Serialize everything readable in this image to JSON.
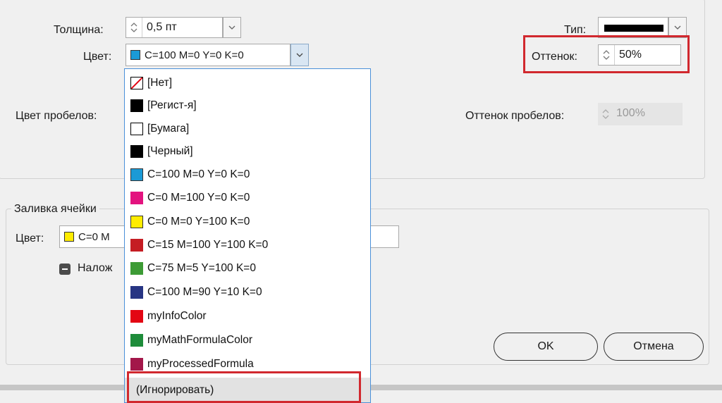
{
  "stroke": {
    "thickness_label": "Толщина:",
    "thickness_value": "0,5 пт",
    "color_label": "Цвет:",
    "color_value": "C=100 M=0 Y=0 K=0",
    "type_label": "Тип:",
    "tint_label": "Оттенок:",
    "tint_value": "50%",
    "gap_color_label": "Цвет пробелов:",
    "gap_tint_label": "Оттенок пробелов:",
    "gap_tint_value": "100%"
  },
  "cell_fill": {
    "legend": "Заливка ячейки",
    "color_label": "Цвет:",
    "color_value_partial": "C=0 M",
    "overprint_label_partial": "Налож"
  },
  "buttons": {
    "ok": "OK",
    "cancel": "Отмена"
  },
  "swatch_menu": {
    "items": [
      {
        "label": "[Нет]",
        "swatch": "none"
      },
      {
        "label": "[Регист-я]",
        "swatch": "#000000"
      },
      {
        "label": "[Бумага]",
        "swatch": "#ffffff"
      },
      {
        "label": "[Черный]",
        "swatch": "#000000"
      },
      {
        "label": "C=100 M=0 Y=0 K=0",
        "swatch": "#1b9ad6"
      },
      {
        "label": "C=0 M=100 Y=0 K=0",
        "swatch": "#e3137f"
      },
      {
        "label": "C=0 M=0 Y=100 K=0",
        "swatch": "#ffec00"
      },
      {
        "label": "C=15 M=100 Y=100 K=0",
        "swatch": "#c51d23"
      },
      {
        "label": "C=75 M=5 Y=100 K=0",
        "swatch": "#3d9b35"
      },
      {
        "label": "C=100 M=90 Y=10 K=0",
        "swatch": "#273583"
      },
      {
        "label": "myInfoColor",
        "swatch": "#e30613"
      },
      {
        "label": "myMathFormulaColor",
        "swatch": "#1e8c3a"
      },
      {
        "label": "myProcessedFormula",
        "swatch": "#a3174a"
      }
    ],
    "ignore_label": "(Игнорировать)"
  },
  "colors": {
    "highlight_red": "#d1282e",
    "accent_blue": "#4a90d9"
  }
}
